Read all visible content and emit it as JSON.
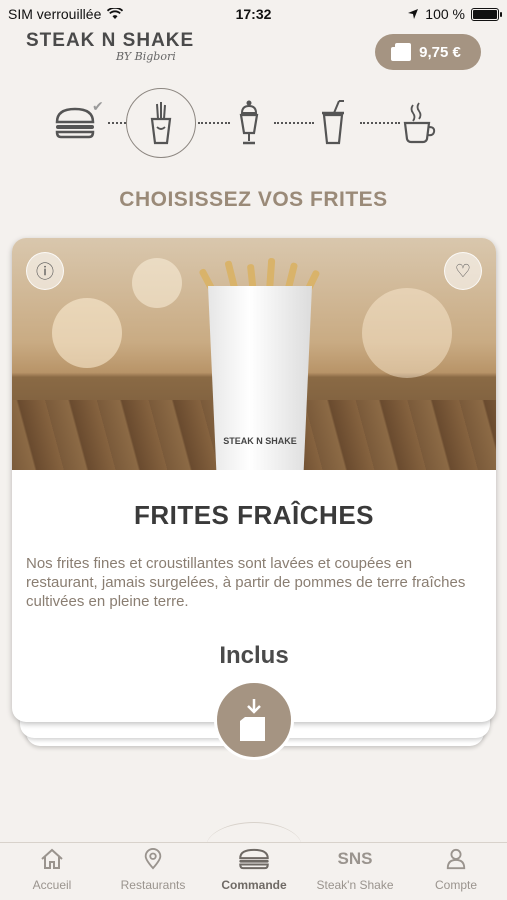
{
  "status_bar": {
    "carrier": "SIM verrouillée",
    "time": "17:32",
    "battery": "100 %"
  },
  "header": {
    "brand": "STEAK N SHAKE",
    "brand_sub": "BY",
    "signature": "Bigbori",
    "cart_total": "9,75 €"
  },
  "steps": [
    {
      "name": "burger",
      "done": true
    },
    {
      "name": "fries",
      "active": true
    },
    {
      "name": "shake"
    },
    {
      "name": "drink"
    },
    {
      "name": "coffee"
    }
  ],
  "page_title": "CHOISISSEZ VOS FRITES",
  "product": {
    "name": "FRITES FRAÎCHES",
    "description": "Nos frites fines et croustillantes sont lavées et coupées en restaurant, jamais surgelées, à partir de pommes de terre fraîches cultivées en pleine terre.",
    "price": "Inclus",
    "box_label": "STEAK N SHAKE",
    "info_icon": "info-icon",
    "favorite_icon": "heart-icon"
  },
  "tabs": [
    {
      "label": "Accueil",
      "icon": "home-icon"
    },
    {
      "label": "Restaurants",
      "icon": "location-pin-icon"
    },
    {
      "label": "Commande",
      "icon": "burger-icon",
      "active": true
    },
    {
      "label": "Steak'n Shake",
      "icon": "sns-icon",
      "icon_text": "SNS"
    },
    {
      "label": "Compte",
      "icon": "user-icon"
    }
  ],
  "colors": {
    "accent": "#a59482",
    "title": "#9a8a78",
    "background": "#f4f1ee"
  }
}
